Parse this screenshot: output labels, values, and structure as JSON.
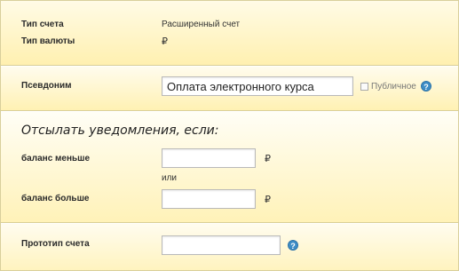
{
  "account": {
    "type_label": "Тип счета",
    "type_value": "Расширенный счет",
    "currency_label": "Тип валюты",
    "currency_value": "₽"
  },
  "alias": {
    "label": "Псевдоним",
    "value": "Оплата электронного курса",
    "public_label": "Публичное",
    "public_checked": false
  },
  "notifications": {
    "heading": "Отсылать уведомления, если:",
    "balance_less_label": "баланс меньше",
    "balance_less_value": "",
    "or_label": "или",
    "balance_more_label": "баланс больше",
    "balance_more_value": "",
    "currency_sign": "₽"
  },
  "prototype": {
    "label": "Прототип счета",
    "value": ""
  },
  "help_icon_glyph": "?",
  "colors": {
    "panel_bg": "#fff2b8",
    "border": "#d9cf98",
    "help_blue": "#3e8dc6"
  }
}
